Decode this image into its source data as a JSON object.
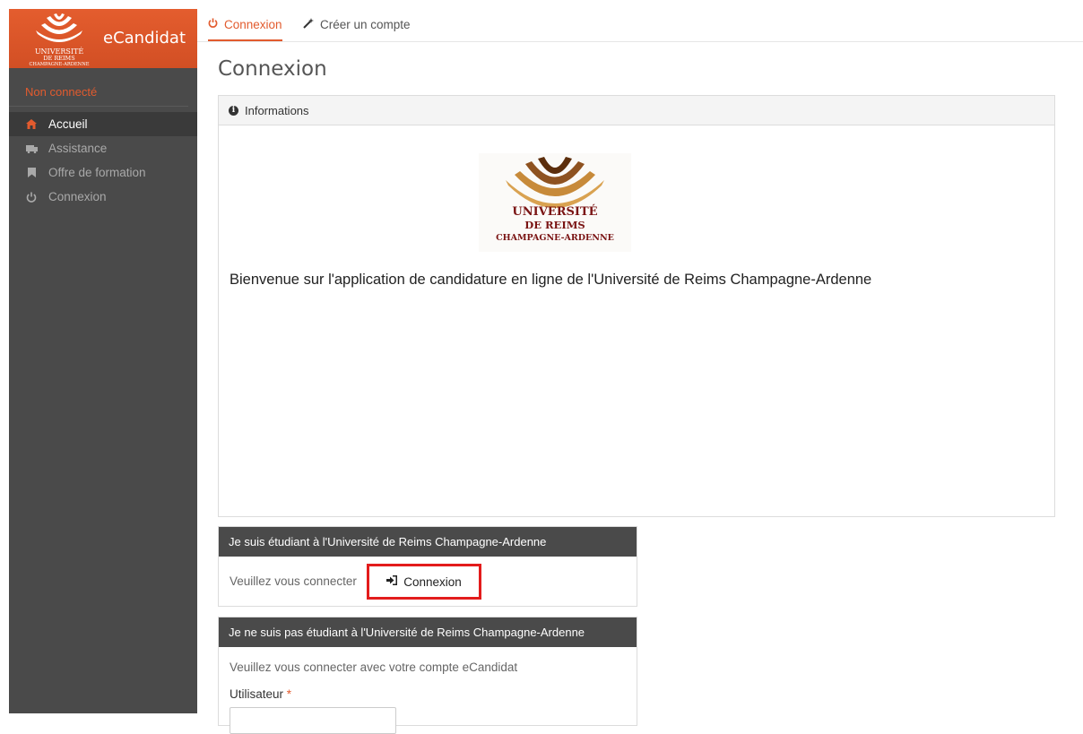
{
  "brand": {
    "app_name": "eCandidat",
    "logo_lines": [
      "UNIVERSITÉ",
      "DE REIMS",
      "CHAMPAGNE-ARDENNE"
    ]
  },
  "sidebar": {
    "status": "Non connecté",
    "items": [
      {
        "label": "Accueil",
        "icon": "home-icon",
        "active": true
      },
      {
        "label": "Assistance",
        "icon": "support-icon",
        "active": false
      },
      {
        "label": "Offre de formation",
        "icon": "bookmark-icon",
        "active": false
      },
      {
        "label": "Connexion",
        "icon": "power-icon",
        "active": false
      }
    ]
  },
  "tabs": [
    {
      "label": "Connexion",
      "icon": "power-icon",
      "active": true
    },
    {
      "label": "Créer un compte",
      "icon": "magic-wand-icon",
      "active": false
    }
  ],
  "page_title": "Connexion",
  "info_panel": {
    "header": "Informations",
    "logo_lines": [
      "UNIVERSITÉ",
      "DE REIMS",
      "CHAMPAGNE-ARDENNE"
    ],
    "welcome": "Bienvenue sur l'application de candidature en ligne de l'Université de Reims Champagne-Ardenne"
  },
  "student_box": {
    "header": "Je suis étudiant à l'Université de Reims Champagne-Ardenne",
    "prompt": "Veuillez vous connecter",
    "button_label": "Connexion"
  },
  "nonstudent_box": {
    "header": "Je ne suis pas étudiant à l'Université de Reims Champagne-Ardenne",
    "prompt": "Veuillez vous connecter avec votre compte eCandidat",
    "user_label": "Utilisateur",
    "required_mark": "*"
  },
  "colors": {
    "accent": "#e25b2e",
    "sidebar_bg": "#4a4a4a",
    "highlight": "#e31c1c"
  }
}
